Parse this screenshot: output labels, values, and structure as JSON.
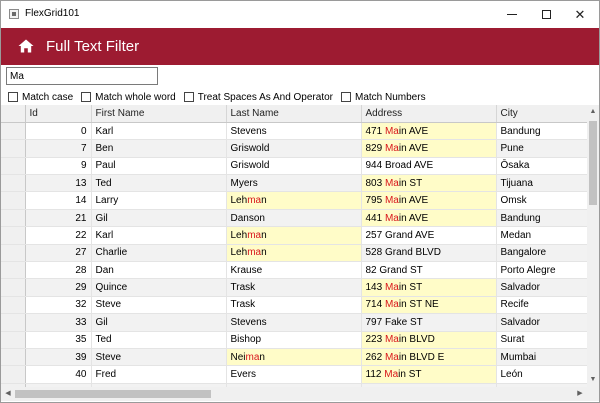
{
  "window": {
    "title": "FlexGrid101"
  },
  "header": {
    "title": "Full Text Filter",
    "color": "#9d1b31"
  },
  "search": {
    "value": "Ma"
  },
  "options": [
    "Match case",
    "Match whole word",
    "Treat Spaces As And Operator",
    "Match Numbers"
  ],
  "grid": {
    "columns": [
      "Id",
      "First Name",
      "Last Name",
      "Address",
      "City"
    ],
    "highlight_color": "#fffcc8",
    "match_color": "#d8171b",
    "rows": [
      {
        "id": "0",
        "first": "Karl",
        "last": "Stevens",
        "address": "471 Main AVE",
        "city": "Bandung"
      },
      {
        "id": "7",
        "first": "Ben",
        "last": "Griswold",
        "address": "829 Main AVE",
        "city": "Pune"
      },
      {
        "id": "9",
        "first": "Paul",
        "last": "Griswold",
        "address": "944 Broad AVE",
        "city": "Ōsaka"
      },
      {
        "id": "13",
        "first": "Ted",
        "last": "Myers",
        "address": "803 Main ST",
        "city": "Tijuana"
      },
      {
        "id": "14",
        "first": "Larry",
        "last": "Lehman",
        "address": "795 Main AVE",
        "city": "Omsk"
      },
      {
        "id": "21",
        "first": "Gil",
        "last": "Danson",
        "address": "441 Main AVE",
        "city": "Bandung"
      },
      {
        "id": "22",
        "first": "Karl",
        "last": "Lehman",
        "address": "257 Grand AVE",
        "city": "Medan"
      },
      {
        "id": "27",
        "first": "Charlie",
        "last": "Lehman",
        "address": "528 Grand BLVD",
        "city": "Bangalore"
      },
      {
        "id": "28",
        "first": "Dan",
        "last": "Krause",
        "address": "82 Grand ST",
        "city": "Porto Alegre"
      },
      {
        "id": "29",
        "first": "Quince",
        "last": "Trask",
        "address": "143 Main ST",
        "city": "Salvador"
      },
      {
        "id": "32",
        "first": "Steve",
        "last": "Trask",
        "address": "714 Main ST NE",
        "city": "Recife"
      },
      {
        "id": "33",
        "first": "Gil",
        "last": "Stevens",
        "address": "797 Fake ST",
        "city": "Salvador"
      },
      {
        "id": "35",
        "first": "Ted",
        "last": "Bishop",
        "address": "223 Main BLVD",
        "city": "Surat"
      },
      {
        "id": "39",
        "first": "Steve",
        "last": "Neiman",
        "address": "262 Main BLVD E",
        "city": "Mumbai"
      },
      {
        "id": "40",
        "first": "Fred",
        "last": "Evers",
        "address": "112 Main ST",
        "city": "León"
      },
      {
        "id": "",
        "first": "",
        "last": "",
        "address": "",
        "city": ""
      }
    ]
  }
}
